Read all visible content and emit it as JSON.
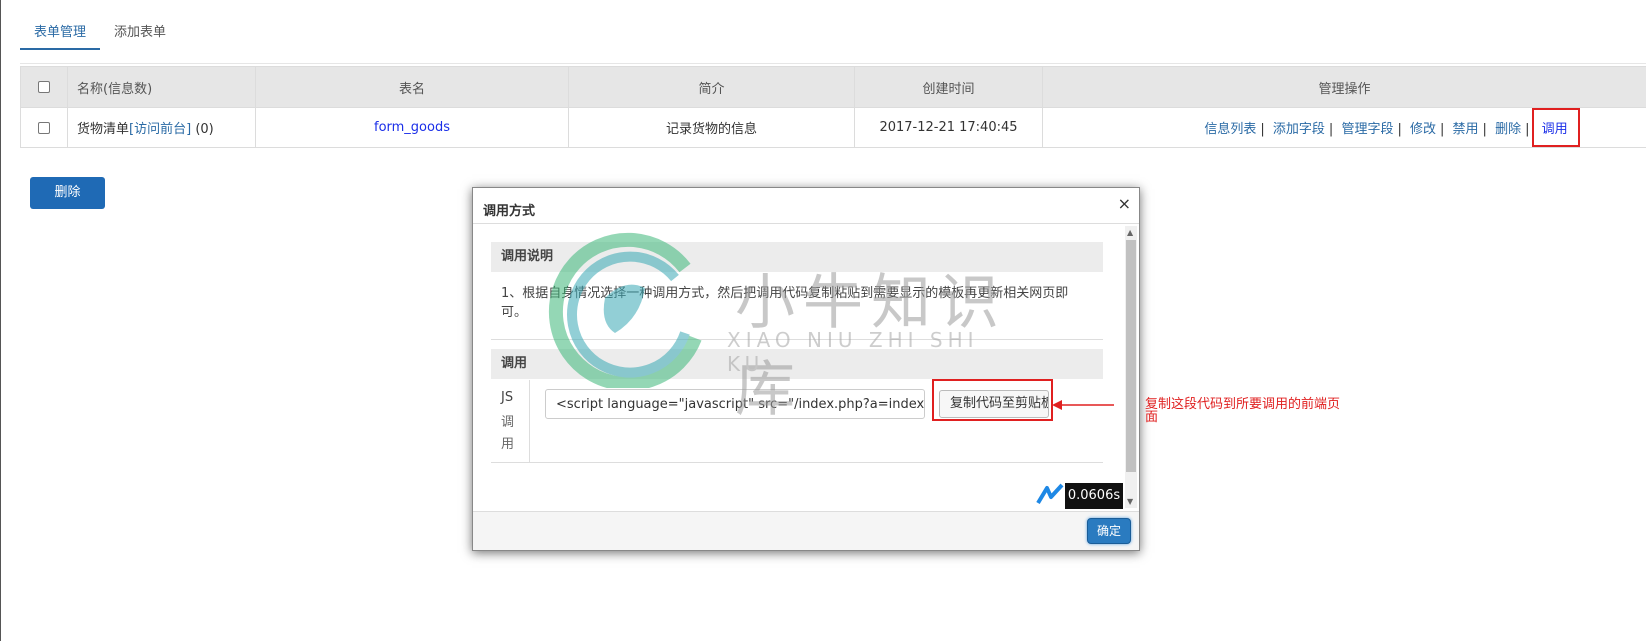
{
  "tabs": [
    {
      "label": "表单管理",
      "active": true
    },
    {
      "label": "添加表单",
      "active": false
    }
  ],
  "table": {
    "headers": [
      "名称(信息数)",
      "表名",
      "简介",
      "创建时间",
      "管理操作"
    ],
    "rows": [
      {
        "name": "货物清单",
        "visit_link": "[访问前台]",
        "count": "(0)",
        "table_name": "form_goods",
        "intro": "记录货物的信息",
        "created": "2017-12-21 17:40:45",
        "ops": [
          "信息列表",
          "添加字段",
          "管理字段",
          "修改",
          "禁用",
          "删除",
          "调用"
        ]
      }
    ]
  },
  "delete_button": "删除",
  "modal": {
    "title": "调用方式",
    "close": "×",
    "section1_title": "调用说明",
    "section1_text": "1、根据自身情况选择一种调用方式，然后把调用代码复制粘贴到需要显示的模板再更新相关网页即可。",
    "section2_title": "调用",
    "js_label": "JS",
    "js_sub": "调用",
    "code_value": "<script language=\"javascript\" src=\"/index.php?a=index&m=Index",
    "copy_button": "复制代码至剪贴板",
    "timer": "0.0606s",
    "ok_button": "确定"
  },
  "annotation": "复制这段代码到所要调用的前端页面",
  "watermark": {
    "text": "小牛知识库",
    "sub": "XIAO NIU ZHI SHI KU"
  },
  "colors": {
    "accent": "#2a6aa5",
    "primary_button": "#1f6ab5",
    "highlight_red": "#e02020"
  }
}
